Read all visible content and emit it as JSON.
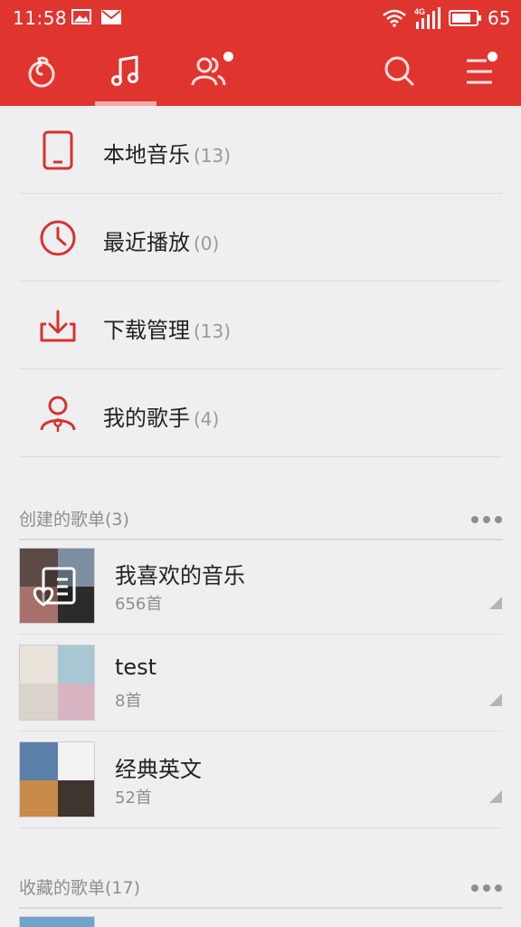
{
  "status_bar": {
    "time": "11:58",
    "network": "4G",
    "battery": "65"
  },
  "nav": {
    "tabs": [
      {
        "icon": "netease-logo-icon",
        "active": false
      },
      {
        "icon": "music-note-icon",
        "active": true
      },
      {
        "icon": "friends-icon",
        "active": false,
        "badge": true
      }
    ],
    "search_icon": "search-icon",
    "menu_icon": "menu-icon",
    "colors": {
      "bar": "#e0342f",
      "underline": "#f4a9a6"
    }
  },
  "quick_list": [
    {
      "icon": "phone-icon",
      "label": "本地音乐",
      "count": "(13)"
    },
    {
      "icon": "clock-icon",
      "label": "最近播放",
      "count": "(0)"
    },
    {
      "icon": "download-icon",
      "label": "下载管理",
      "count": "(13)"
    },
    {
      "icon": "singer-icon",
      "label": "我的歌手",
      "count": "(4)"
    }
  ],
  "created_section": {
    "title": "创建的歌单(3)",
    "playlists": [
      {
        "name": "我喜欢的音乐",
        "count": "656首",
        "cover": "heart-list-cover"
      },
      {
        "name": "test",
        "count": "8首",
        "cover": "collage-cover"
      },
      {
        "name": "经典英文",
        "count": "52首",
        "cover": "collage-cover"
      }
    ]
  },
  "collected_section": {
    "title": "收藏的歌单(17)"
  },
  "accent_color": "#d8332d"
}
